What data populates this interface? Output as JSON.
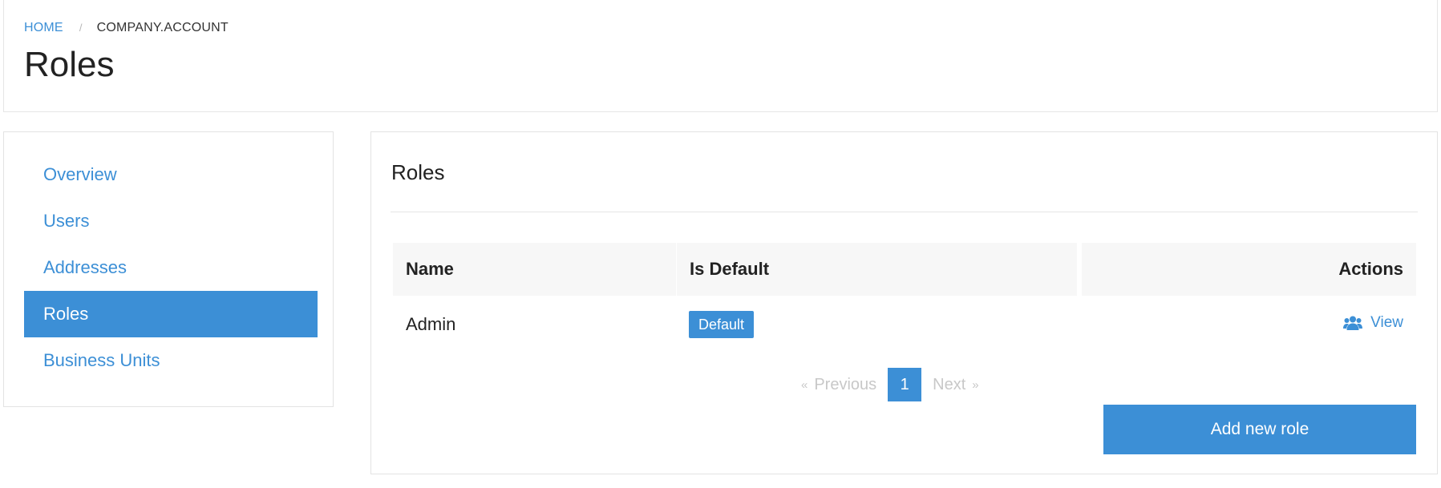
{
  "breadcrumb": {
    "home": "HOME",
    "separator": "/",
    "current": "COMPANY.ACCOUNT"
  },
  "page": {
    "title": "Roles"
  },
  "sidebar": {
    "items": [
      {
        "label": "Overview",
        "active": false
      },
      {
        "label": "Users",
        "active": false
      },
      {
        "label": "Addresses",
        "active": false
      },
      {
        "label": "Roles",
        "active": true
      },
      {
        "label": "Business Units",
        "active": false
      }
    ]
  },
  "main": {
    "title": "Roles",
    "table": {
      "headers": {
        "name": "Name",
        "is_default": "Is Default",
        "actions": "Actions"
      },
      "rows": [
        {
          "name": "Admin",
          "is_default": "Default",
          "action": "View",
          "action_icon": "users-icon"
        }
      ]
    },
    "pagination": {
      "prev_chevron": "«",
      "prev": "Previous",
      "current_page": "1",
      "next": "Next",
      "next_chevron": "»"
    },
    "add_button": "Add new role"
  },
  "colors": {
    "accent": "#3c8fd6",
    "disabled": "#c8c8c8",
    "header_bg": "#f7f7f7"
  }
}
